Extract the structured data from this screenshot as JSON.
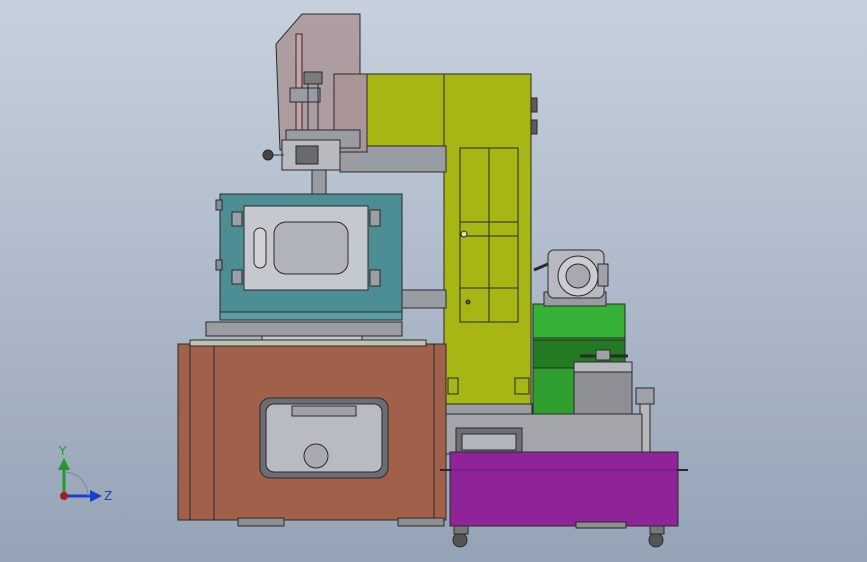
{
  "view": {
    "background_top": "#c7d1dd",
    "background_bottom": "#95a3b7"
  },
  "triad": {
    "y_label": "Y",
    "z_label": "Z",
    "y_color": "#1f9a2f",
    "z_color": "#1c3fc8",
    "origin_color": "#b01818"
  },
  "colors": {
    "column": "#a7b515",
    "cabinet": "#a1604a",
    "chamber": "#4c8e94",
    "drive_unit": "#2f9e2f",
    "tank": "#8e2497",
    "guard": "#a99496",
    "steel": "#9a9ca4",
    "filter": "#8d8f95"
  }
}
